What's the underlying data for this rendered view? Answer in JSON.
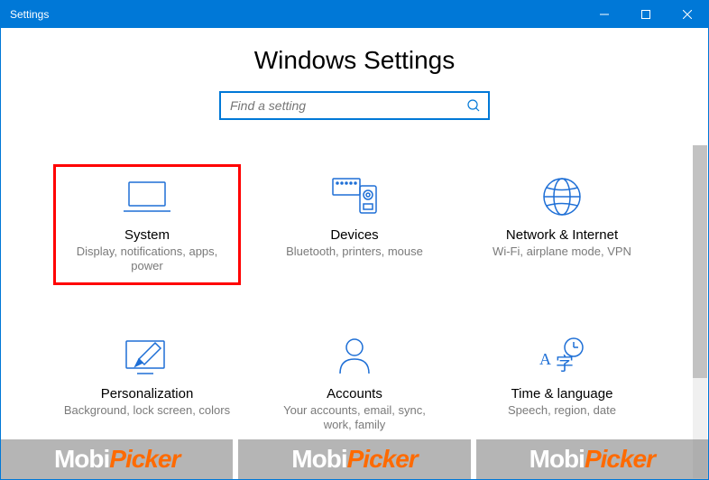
{
  "window": {
    "title": "Settings"
  },
  "page": {
    "heading": "Windows Settings"
  },
  "search": {
    "placeholder": "Find a setting"
  },
  "cards": [
    {
      "title": "System",
      "desc": "Display, notifications, apps, power",
      "highlight": true
    },
    {
      "title": "Devices",
      "desc": "Bluetooth, printers, mouse",
      "highlight": false
    },
    {
      "title": "Network & Internet",
      "desc": "Wi-Fi, airplane mode, VPN",
      "highlight": false
    },
    {
      "title": "Personalization",
      "desc": "Background, lock screen, colors",
      "highlight": false
    },
    {
      "title": "Accounts",
      "desc": "Your accounts, email, sync, work, family",
      "highlight": false
    },
    {
      "title": "Time & language",
      "desc": "Speech, region, date",
      "highlight": false
    }
  ],
  "watermark": {
    "brand_a": "Mobi",
    "brand_b": "Picker"
  }
}
